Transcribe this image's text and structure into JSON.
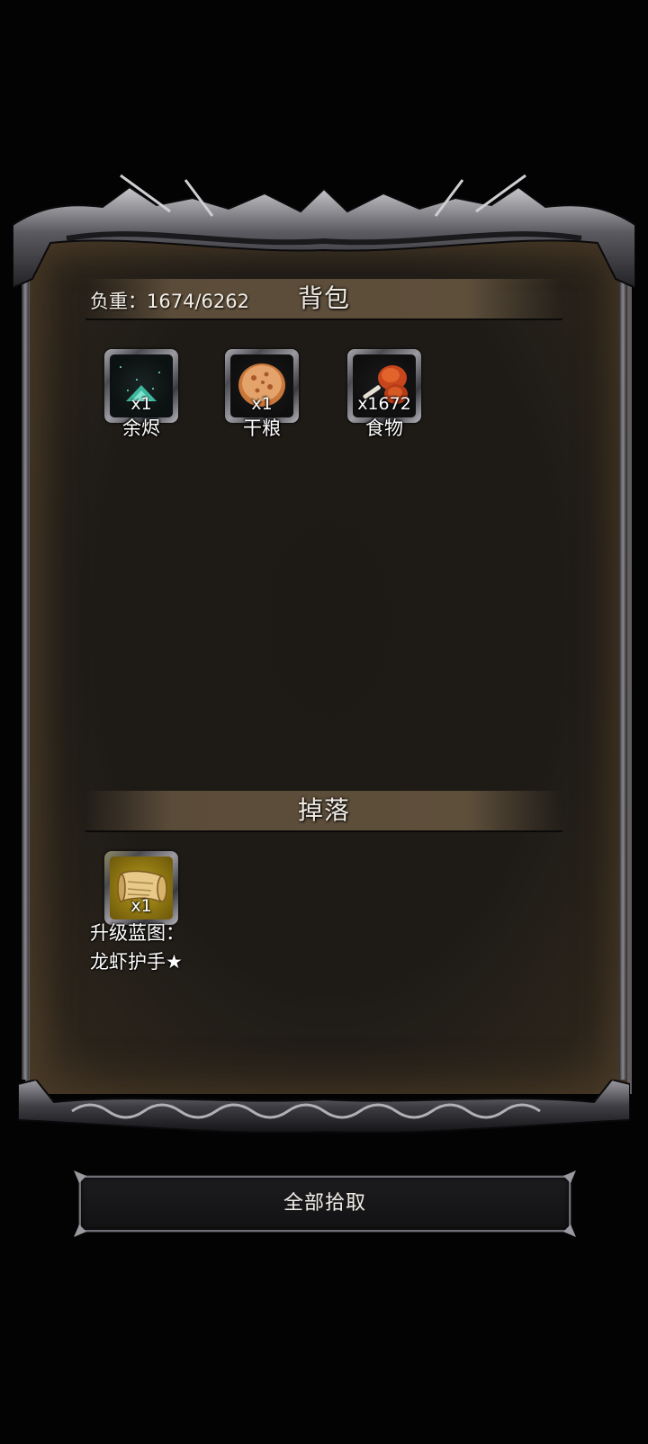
{
  "backpack": {
    "weight_label": "负重：1674/6262",
    "title": "背包",
    "items": [
      {
        "name": "余烬",
        "count": "x1",
        "icon": "ember-icon"
      },
      {
        "name": "干粮",
        "count": "x1",
        "icon": "biscuit-icon"
      },
      {
        "name": "食物",
        "count": "x1672",
        "icon": "drumstick-icon"
      }
    ]
  },
  "drops": {
    "title": "掉落",
    "items": [
      {
        "name_line1": "升级蓝图：",
        "name_line2": "龙虾护手★",
        "count": "x1",
        "icon": "scroll-icon"
      }
    ]
  },
  "actions": {
    "pickup_all_label": "全部拾取"
  },
  "colors": {
    "background": "#030303",
    "panel": "#1e1b17",
    "header_band": "#5e4f3b",
    "text": "#f0ebe3"
  }
}
